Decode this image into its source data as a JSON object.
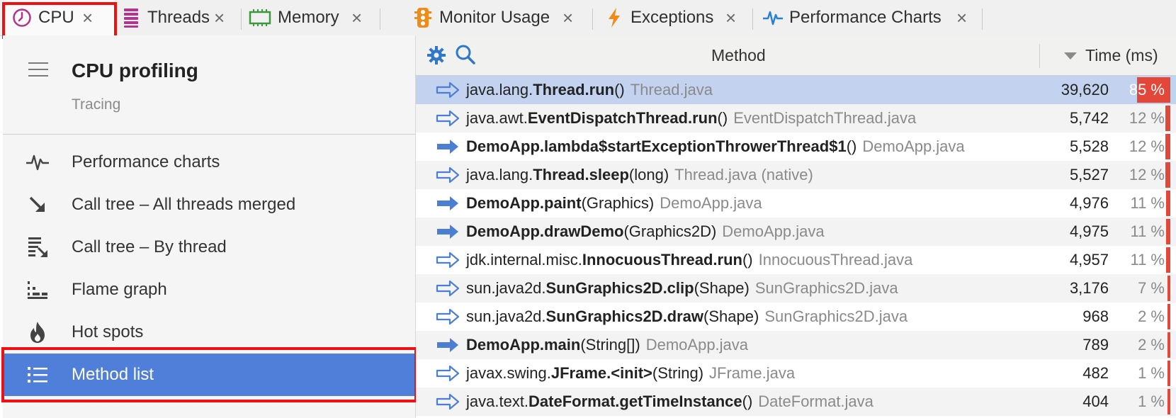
{
  "tabs": [
    {
      "label": "CPU",
      "icon": "clock-icon"
    },
    {
      "label": "Threads",
      "icon": "threads-stack-icon"
    },
    {
      "label": "Memory",
      "icon": "memory-chip-icon"
    },
    {
      "label": "Monitor Usage",
      "icon": "traffic-light-icon"
    },
    {
      "label": "Exceptions",
      "icon": "lightning-icon"
    },
    {
      "label": "Performance Charts",
      "icon": "pulse-icon"
    }
  ],
  "tab_close_glyph": "×",
  "sidebar": {
    "title": "CPU profiling",
    "subtitle": "Tracing",
    "items": [
      {
        "label": "Performance charts",
        "icon": "pulse-icon"
      },
      {
        "label": "Call tree – All threads merged",
        "icon": "arrow-down-right-icon"
      },
      {
        "label": "Call tree – By thread",
        "icon": "call-tree-thread-icon"
      },
      {
        "label": "Flame graph",
        "icon": "flame-graph-icon"
      },
      {
        "label": "Hot spots",
        "icon": "flame-icon"
      },
      {
        "label": "Method list",
        "icon": "list-icon",
        "selected": true
      }
    ]
  },
  "table": {
    "method_header": "Method",
    "time_header": "Time (ms)",
    "rows": [
      {
        "pre": "java.lang.",
        "bold": "Thread.run",
        "post": "()",
        "file": "Thread.java",
        "time": "39,620",
        "pct": "85 %",
        "pct_value": 85,
        "arrow": "outline",
        "selected": true
      },
      {
        "pre": "java.awt.",
        "bold": "EventDispatchThread.run",
        "post": "()",
        "file": "EventDispatchThread.java",
        "time": "5,742",
        "pct": "12 %",
        "pct_value": 12,
        "arrow": "outline"
      },
      {
        "pre": "",
        "bold": "DemoApp.lambda$startExceptionThrowerThread$1",
        "post": "()",
        "file": "DemoApp.java",
        "time": "5,528",
        "pct": "12 %",
        "pct_value": 12,
        "arrow": "filled"
      },
      {
        "pre": "java.lang.",
        "bold": "Thread.sleep",
        "post": "(long)",
        "file": "Thread.java (native)",
        "time": "5,527",
        "pct": "12 %",
        "pct_value": 12,
        "arrow": "outline"
      },
      {
        "pre": "",
        "bold": "DemoApp.paint",
        "post": "(Graphics)",
        "file": "DemoApp.java",
        "time": "4,976",
        "pct": "11 %",
        "pct_value": 11,
        "arrow": "filled"
      },
      {
        "pre": "",
        "bold": "DemoApp.drawDemo",
        "post": "(Graphics2D)",
        "file": "DemoApp.java",
        "time": "4,975",
        "pct": "11 %",
        "pct_value": 11,
        "arrow": "filled"
      },
      {
        "pre": "jdk.internal.misc.",
        "bold": "InnocuousThread.run",
        "post": "()",
        "file": "InnocuousThread.java",
        "time": "4,957",
        "pct": "11 %",
        "pct_value": 11,
        "arrow": "outline"
      },
      {
        "pre": "sun.java2d.",
        "bold": "SunGraphics2D.clip",
        "post": "(Shape)",
        "file": "SunGraphics2D.java",
        "time": "3,176",
        "pct": "7 %",
        "pct_value": 7,
        "arrow": "outline"
      },
      {
        "pre": "sun.java2d.",
        "bold": "SunGraphics2D.draw",
        "post": "(Shape)",
        "file": "SunGraphics2D.java",
        "time": "968",
        "pct": "2 %",
        "pct_value": 2,
        "arrow": "outline"
      },
      {
        "pre": "",
        "bold": "DemoApp.main",
        "post": "(String[])",
        "file": "DemoApp.java",
        "time": "789",
        "pct": "2 %",
        "pct_value": 2,
        "arrow": "filled"
      },
      {
        "pre": "javax.swing.",
        "bold": "JFrame.<init>",
        "post": "(String)",
        "file": "JFrame.java",
        "time": "482",
        "pct": "1 %",
        "pct_value": 1,
        "arrow": "outline"
      },
      {
        "pre": "java.text.",
        "bold": "DateFormat.getTimeInstance",
        "post": "()",
        "file": "DateFormat.java",
        "time": "404",
        "pct": "1 %",
        "pct_value": 1,
        "arrow": "outline"
      }
    ]
  },
  "colors": {
    "selection_blue": "#4f7fd8",
    "row_selected": "#c3d3ef",
    "percent_bar": "#e2473a",
    "arrow_blue": "#4a7fd4",
    "highlight_red": "#ee1111"
  }
}
